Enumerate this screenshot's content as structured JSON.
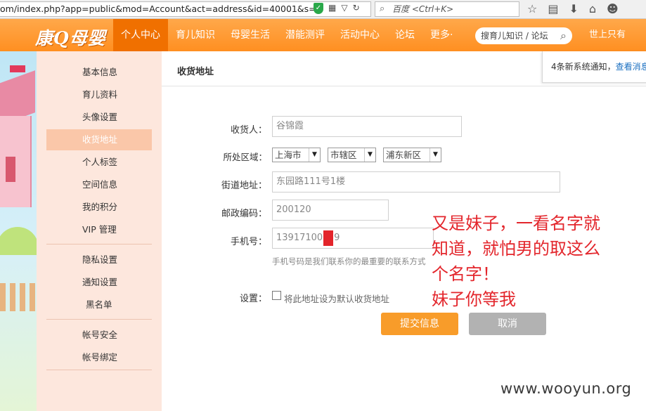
{
  "browser": {
    "url": "om/index.php?app=public&mod=Account&act=address&id=40001&s=1",
    "search_engine": "百度",
    "search_shortcut": "<Ctrl+K>",
    "shield_icon": "shield-icon"
  },
  "site": {
    "logo": "康Q母婴",
    "nav": [
      "个人中心",
      "育儿知识",
      "母婴生活",
      "潜能测评",
      "活动中心",
      "论坛",
      "更多·"
    ],
    "search_placeholder": "搜育儿知识 / 论坛",
    "username": "世上只有",
    "accent_color": "#ff8f21",
    "active_color": "#f07000"
  },
  "sidebar": {
    "items": [
      "基本信息",
      "育儿资料",
      "头像设置",
      "收货地址",
      "个人标签",
      "空间信息",
      "我的积分",
      "VIP 管理",
      "隐私设置",
      "通知设置",
      "黑名单",
      "帐号安全",
      "帐号绑定"
    ],
    "active": "收货地址"
  },
  "content": {
    "title": "收货地址",
    "notice_text": "4条新系统通知，",
    "notice_link": "查看消息"
  },
  "form": {
    "receiver_label": "收货人：",
    "receiver_value": "谷锦霞",
    "region_label": "所处区域：",
    "province": "上海市",
    "city": "市辖区",
    "district": "浦东新区",
    "street_label": "街道地址：",
    "street_value": "东园路111号1楼",
    "zip_label": "邮政编码：",
    "zip_value": "200120",
    "phone_label": "手机号：",
    "phone_prefix": "13917100",
    "phone_suffix": "9",
    "phone_hint": "手机号码是我们联系你的最重要的联系方式",
    "settings_label": "设置：",
    "default_checkbox_label": "将此地址设为默认收货地址",
    "default_checked": false,
    "submit_label": "提交信息",
    "cancel_label": "取消"
  },
  "annotation": {
    "lines": [
      "又是妹子，一看名字就",
      "知道，就怕男的取这么",
      "个名字！",
      "妹子你等我"
    ]
  },
  "watermark": "www.wooyun.org"
}
